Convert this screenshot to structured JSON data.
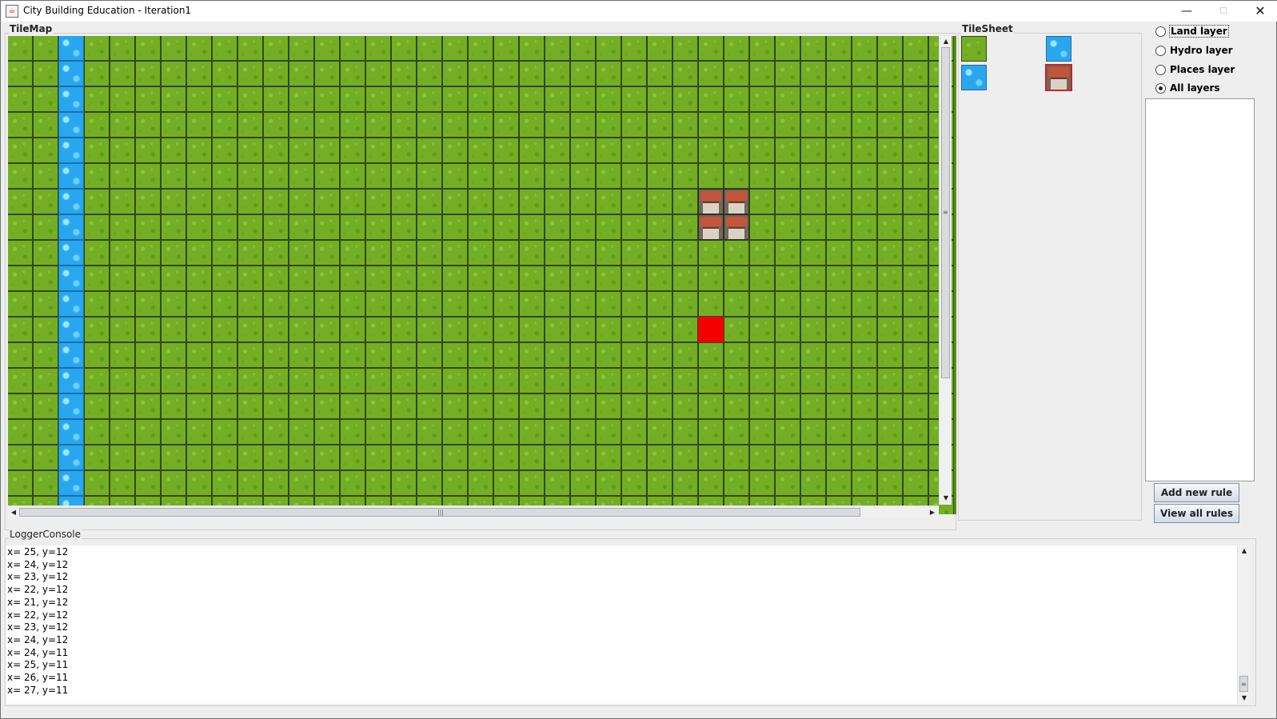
{
  "window": {
    "title": "City Building Education - Iteration1",
    "controls": {
      "minimize": "—",
      "maximize": "☐",
      "close": "✕"
    }
  },
  "tilemap": {
    "title": "TileMap",
    "columns": 37,
    "rows": 19,
    "water_column": 2,
    "houses": [
      [
        27,
        6
      ],
      [
        28,
        6
      ],
      [
        27,
        7
      ],
      [
        28,
        7
      ]
    ],
    "selected_tile": [
      27,
      11
    ],
    "selected_color": "#f40000"
  },
  "tilesheet": {
    "title": "TileSheet",
    "tiles": [
      {
        "kind": "grass",
        "icon": "grass-tile-icon"
      },
      {
        "kind": "water",
        "icon": "water-tile-icon"
      },
      {
        "kind": "water",
        "icon": "water-tile-icon"
      },
      {
        "kind": "house",
        "icon": "house-tile-icon",
        "selected": true
      }
    ]
  },
  "layers": {
    "options": [
      {
        "label": "Land layer",
        "checked": false,
        "focused": true
      },
      {
        "label": "Hydro layer",
        "checked": false,
        "focused": false
      },
      {
        "label": "Places layer",
        "checked": false,
        "focused": false
      },
      {
        "label": "All layers",
        "checked": true,
        "focused": false
      }
    ]
  },
  "rules": {
    "add_label": "Add new rule",
    "view_label": "View all rules"
  },
  "logger": {
    "title": "LoggerConsole",
    "lines": [
      "x= 25, y=12",
      "x= 24, y=12",
      "x= 23, y=12",
      "x= 22, y=12",
      "x= 21, y=12",
      "x= 22, y=12",
      "x= 23, y=12",
      "x= 24, y=12",
      "x= 24, y=11",
      "x= 25, y=11",
      "x= 26, y=11",
      "x= 27, y=11"
    ]
  },
  "colors": {
    "grass": "#74ae25",
    "water": "#28a7ef",
    "house_roof": "#c4553a",
    "panel_bg": "#eeeeee"
  }
}
